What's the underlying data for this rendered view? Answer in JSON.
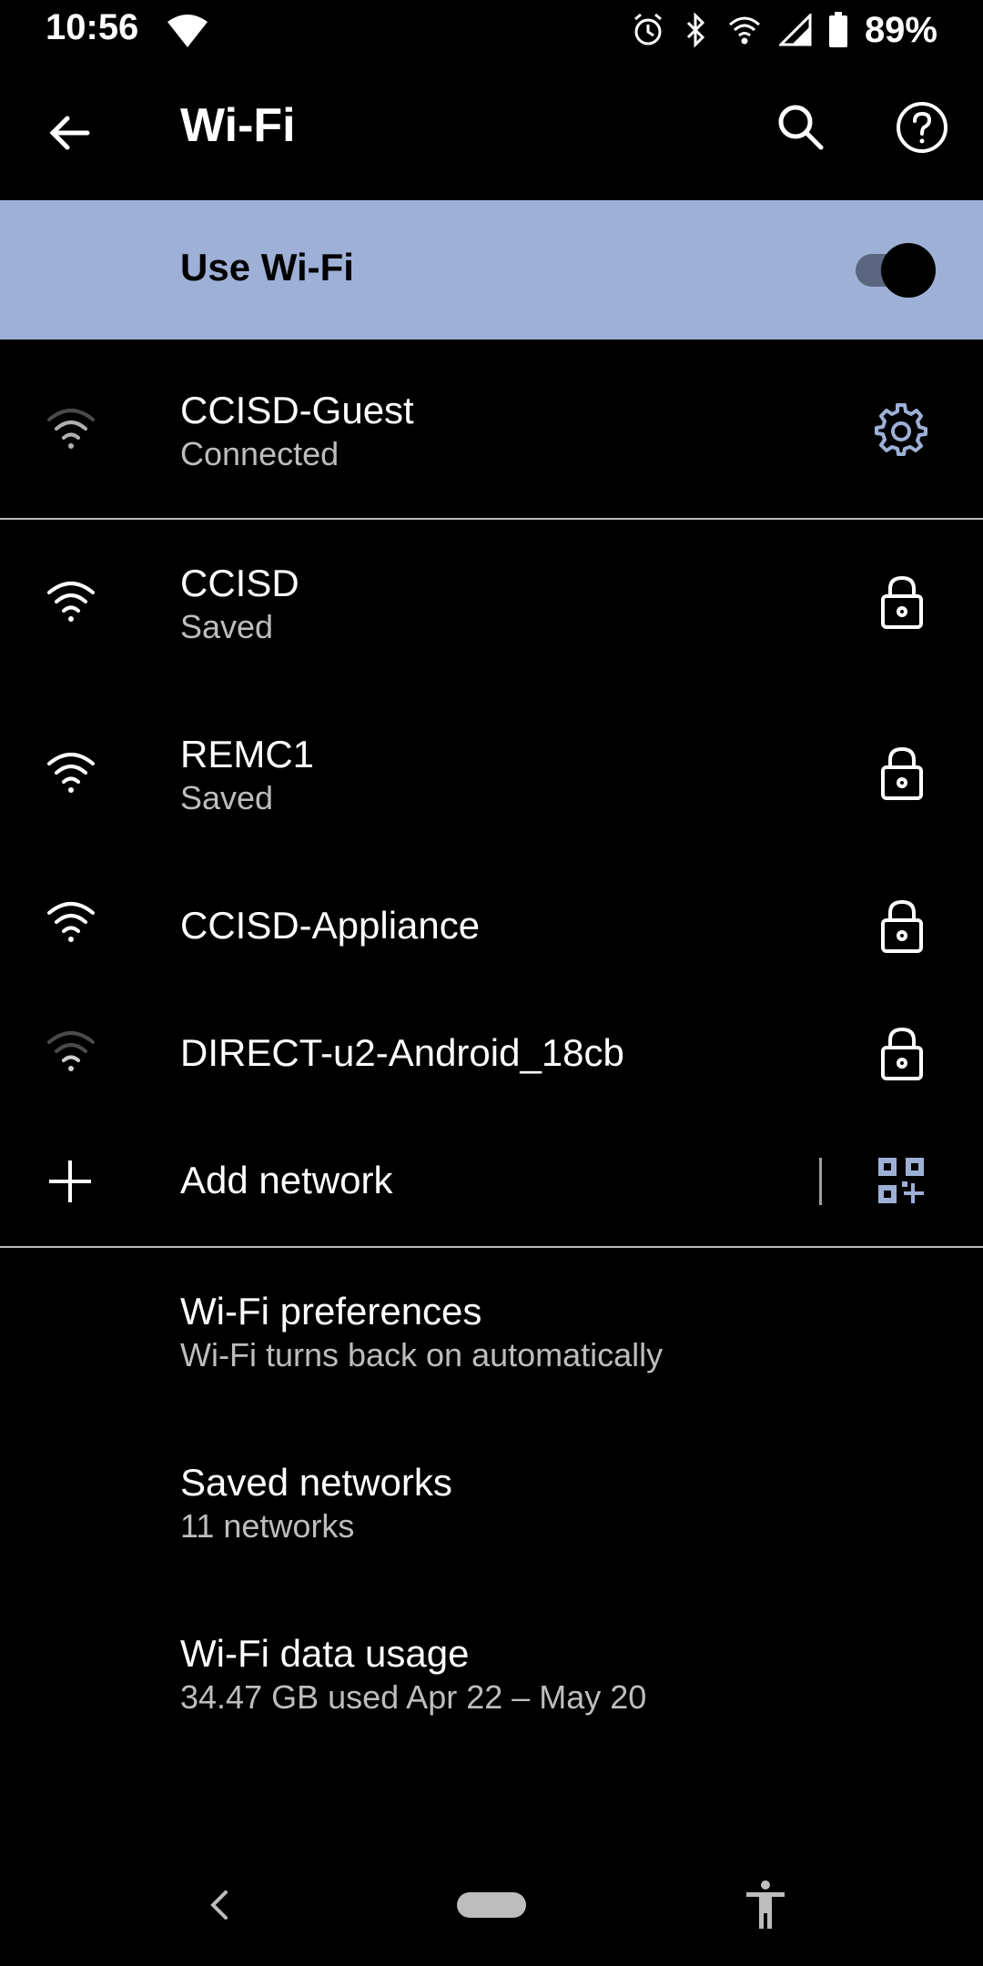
{
  "status_bar": {
    "time": "10:56",
    "battery_percent": "89%"
  },
  "app_bar": {
    "title": "Wi-Fi"
  },
  "master_switch": {
    "label": "Use Wi-Fi",
    "enabled": true
  },
  "connected_network": {
    "name": "CCISD-Guest",
    "status": "Connected"
  },
  "networks": [
    {
      "name": "CCISD",
      "status": "Saved"
    },
    {
      "name": "REMC1",
      "status": "Saved"
    },
    {
      "name": "CCISD-Appliance",
      "status": ""
    },
    {
      "name": "DIRECT-u2-Android_18cb",
      "status": ""
    }
  ],
  "add_network": {
    "label": "Add network"
  },
  "settings": [
    {
      "title": "Wi-Fi preferences",
      "subtitle": "Wi-Fi turns back on automatically"
    },
    {
      "title": "Saved networks",
      "subtitle": "11 networks"
    },
    {
      "title": "Wi-Fi data usage",
      "subtitle": "34.47 GB used Apr 22 – May 20"
    }
  ],
  "colors": {
    "background": "#000000",
    "master_bg": "#9eb0d6",
    "accent_icon": "#9eb0d6",
    "secondary_text": "#bdbdbd"
  }
}
